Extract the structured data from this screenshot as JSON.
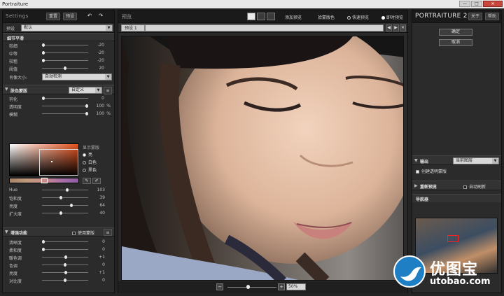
{
  "window": {
    "title": "Portraiture",
    "controls": [
      "—",
      "□",
      "✕"
    ]
  },
  "left": {
    "title": "Settings",
    "reset_label": "重置",
    "preset_btn_label": "预设",
    "undo_icon": "undo-icon",
    "redo_icon": "redo-icon",
    "preset_label": "预设",
    "preset_value": "默认",
    "detail_section": {
      "title": "细节平滑",
      "sliders": [
        {
          "label": "较细",
          "value": "-20",
          "pos": 0.0
        },
        {
          "label": "中等",
          "value": "-20",
          "pos": 0.0
        },
        {
          "label": "较粗",
          "value": "-20",
          "pos": 0.0
        },
        {
          "label": "阈值",
          "value": "20",
          "pos": 0.5
        }
      ],
      "size_label": "肖像大小:",
      "size_value": "自动检测"
    },
    "mask_section": {
      "title": "肤色蒙版",
      "mode_value": "自定义",
      "sliders": [
        {
          "label": "羽化",
          "value": "0",
          "unit": "",
          "pos": 0.0
        },
        {
          "label": "透明度",
          "value": "100",
          "unit": "%",
          "pos": 1.0
        },
        {
          "label": "模糊",
          "value": "100",
          "unit": "%",
          "pos": 1.0
        }
      ],
      "show_mask_label": "显示蒙版",
      "radio_options": [
        "亮",
        "白色",
        "黑色"
      ],
      "hsl_sliders": [
        {
          "label": "Hue",
          "value": "103",
          "unit": "",
          "pos": 0.55
        },
        {
          "label": "饱和度",
          "value": "39",
          "unit": "",
          "pos": 0.4
        },
        {
          "label": "亮度",
          "value": "64",
          "unit": "",
          "pos": 0.64
        },
        {
          "label": "扩大度",
          "value": "40",
          "unit": "",
          "pos": 0.4
        }
      ]
    },
    "enhance_section": {
      "title": "增强功能",
      "use_mask_label": "使用蒙版",
      "sliders": [
        {
          "label": "清晰度",
          "value": "0",
          "pos": 0.0
        },
        {
          "label": "柔和度",
          "value": "0",
          "pos": 0.0
        },
        {
          "label": "暖色调",
          "value": "+1",
          "pos": 0.52
        },
        {
          "label": "色调",
          "value": "0",
          "pos": 0.5
        },
        {
          "label": "亮度",
          "value": "+1",
          "pos": 0.52
        },
        {
          "label": "对比度",
          "value": "0",
          "pos": 0.5
        }
      ]
    }
  },
  "center": {
    "title": "预览",
    "toolbar": {
      "add_preview": "添加预览",
      "color_picker": "拾蒙版色",
      "instant_preview": "快速预览",
      "realtime_preview": "即时预览"
    },
    "tab_label": "预设 1",
    "zoom_value": "50%",
    "zoom_minus": "−",
    "zoom_plus": "+"
  },
  "right": {
    "brand": "PORTRAITURE 2",
    "about_label": "关于",
    "help_label": "帮助",
    "ok_label": "确定",
    "cancel_label": "取消",
    "output_section": {
      "title": "输出",
      "output_value": "当前图层",
      "transparency_label": "创建透明蒙版"
    },
    "reset_preview_section": {
      "title": "重新预览",
      "auto_refresh_label": "自动刷新"
    },
    "navigator_title": "导航器"
  },
  "watermark": {
    "big": "优图宝",
    "small": "utobao.com"
  }
}
